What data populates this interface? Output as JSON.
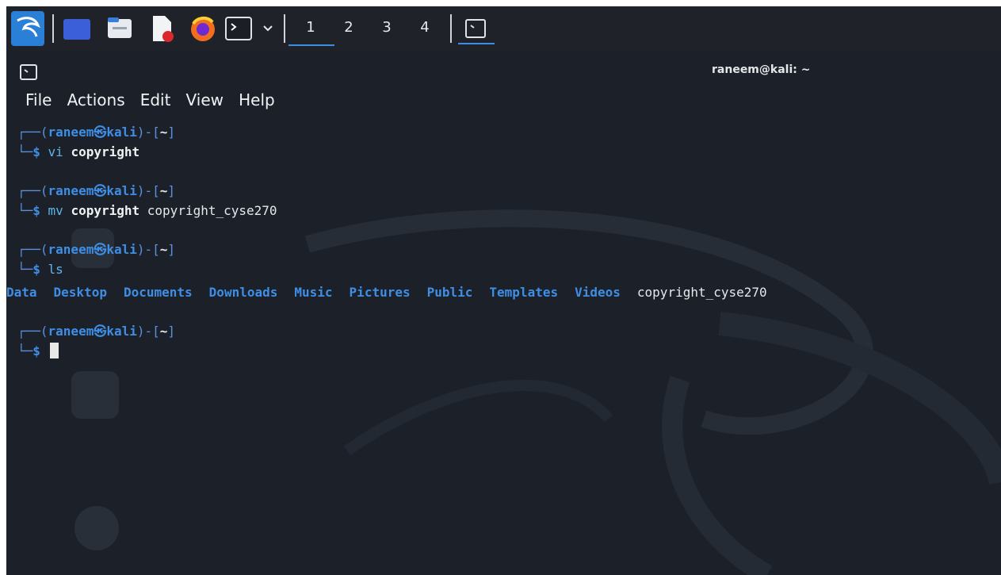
{
  "panel": {
    "workspaces": [
      "1",
      "2",
      "3",
      "4"
    ],
    "active_workspace": "1",
    "icons": [
      "kali-menu-icon",
      "show-desktop-icon",
      "file-manager-icon",
      "text-editor-icon",
      "firefox-icon",
      "terminal-icon",
      "chevron-down-icon",
      "terminal-task-icon"
    ]
  },
  "window": {
    "title": "raneem@kali: ~",
    "menu": [
      "File",
      "Actions",
      "Edit",
      "View",
      "Help"
    ]
  },
  "terminal": {
    "user": "raneem",
    "host": "kali",
    "cwd": "~",
    "commands": [
      {
        "cmd": "vi",
        "args_bold": "copyright",
        "args": ""
      },
      {
        "cmd": "mv",
        "args_bold": "copyright",
        "args": "copyright_cyse270"
      },
      {
        "cmd": "ls",
        "args_bold": "",
        "args": ""
      }
    ],
    "ls_dirs": [
      "Data",
      "Desktop",
      "Documents",
      "Downloads",
      "Music",
      "Pictures",
      "Public",
      "Templates",
      "Videos"
    ],
    "ls_files": [
      "copyright_cyse270"
    ]
  },
  "colors": {
    "background": "#1c2129",
    "accent": "#3f8ee6"
  }
}
